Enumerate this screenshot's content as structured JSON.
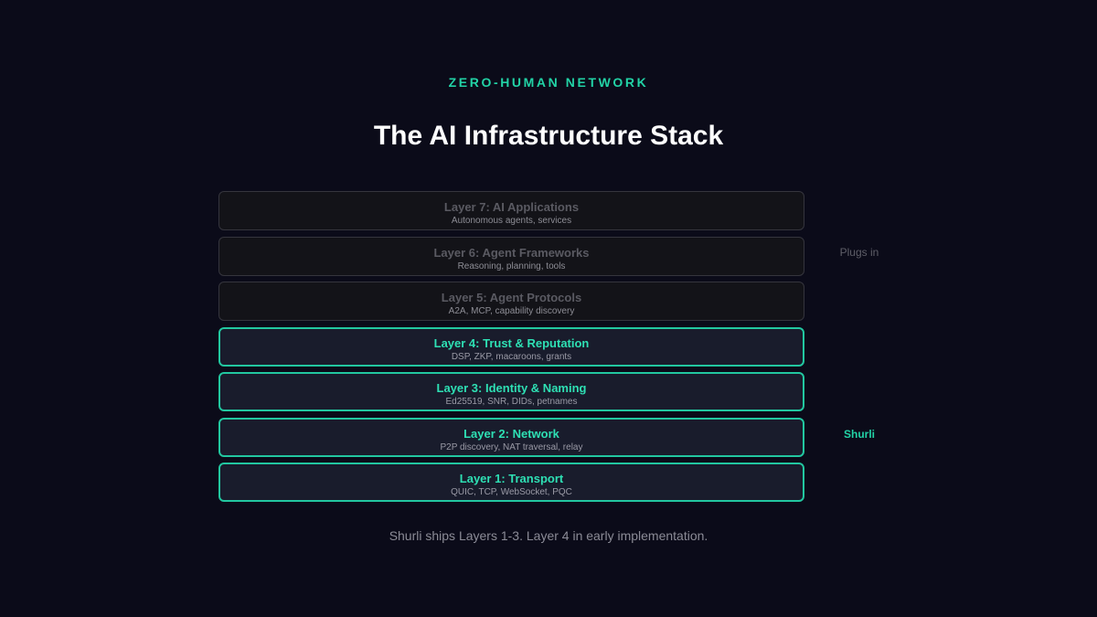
{
  "header": {
    "eyebrow": "ZERO-HUMAN NETWORK",
    "title": "The AI Infrastructure Stack"
  },
  "stack": {
    "layers": [
      {
        "name": "Layer 7: AI Applications",
        "description": "Autonomous agents, services",
        "status": "external"
      },
      {
        "name": "Layer 6: Agent Frameworks",
        "description": "Reasoning, planning, tools",
        "status": "external"
      },
      {
        "name": "Layer 5: Agent Protocols",
        "description": "A2A, MCP, capability discovery",
        "status": "external"
      },
      {
        "name": "Layer 4: Trust & Reputation",
        "description": "DSP, ZKP, macaroons, grants",
        "status": "highlighted"
      },
      {
        "name": "Layer 3: Identity & Naming",
        "description": "Ed25519, SNR, DIDs, petnames",
        "status": "highlighted"
      },
      {
        "name": "Layer 2: Network",
        "description": "P2P discovery, NAT traversal, relay",
        "status": "highlighted"
      },
      {
        "name": "Layer 1: Transport",
        "description": "QUIC, TCP, WebSocket, PQC",
        "status": "highlighted"
      }
    ]
  },
  "side_labels": {
    "upper": "Plugs in",
    "lower": "Shurli"
  },
  "footer": {
    "note": "Shurli ships Layers 1-3. Layer 4 in early implementation."
  },
  "colors": {
    "background": "#0b0b19",
    "accent": "#22d3a6",
    "dim_border": "#35353d"
  }
}
